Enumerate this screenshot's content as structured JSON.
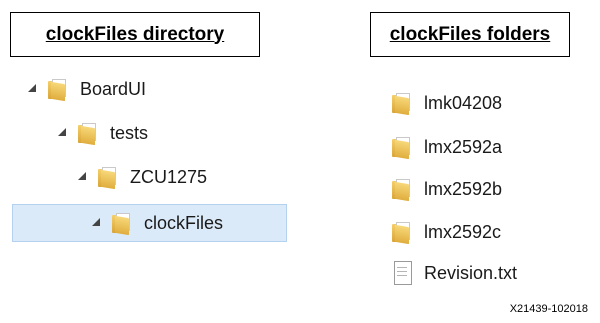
{
  "left_panel": {
    "title": "clockFiles directory",
    "tree": [
      {
        "label": "BoardUI",
        "icon": "folder-icon"
      },
      {
        "label": "tests",
        "icon": "folder-icon"
      },
      {
        "label": "ZCU1275",
        "icon": "folder-icon"
      },
      {
        "label": "clockFiles",
        "icon": "folder-icon",
        "selected": true
      }
    ]
  },
  "right_panel": {
    "title": "clockFiles folders",
    "items": [
      {
        "label": "lmk04208",
        "icon": "folder-icon"
      },
      {
        "label": "lmx2592a",
        "icon": "folder-icon"
      },
      {
        "label": "lmx2592b",
        "icon": "folder-icon"
      },
      {
        "label": "lmx2592c",
        "icon": "folder-icon"
      },
      {
        "label": "Revision.txt",
        "icon": "text-file-icon"
      }
    ]
  },
  "figure_id": "X21439-102018",
  "colors": {
    "selection_bg": "#dbeaf8",
    "folder_yellow": "#e0ad3e"
  }
}
